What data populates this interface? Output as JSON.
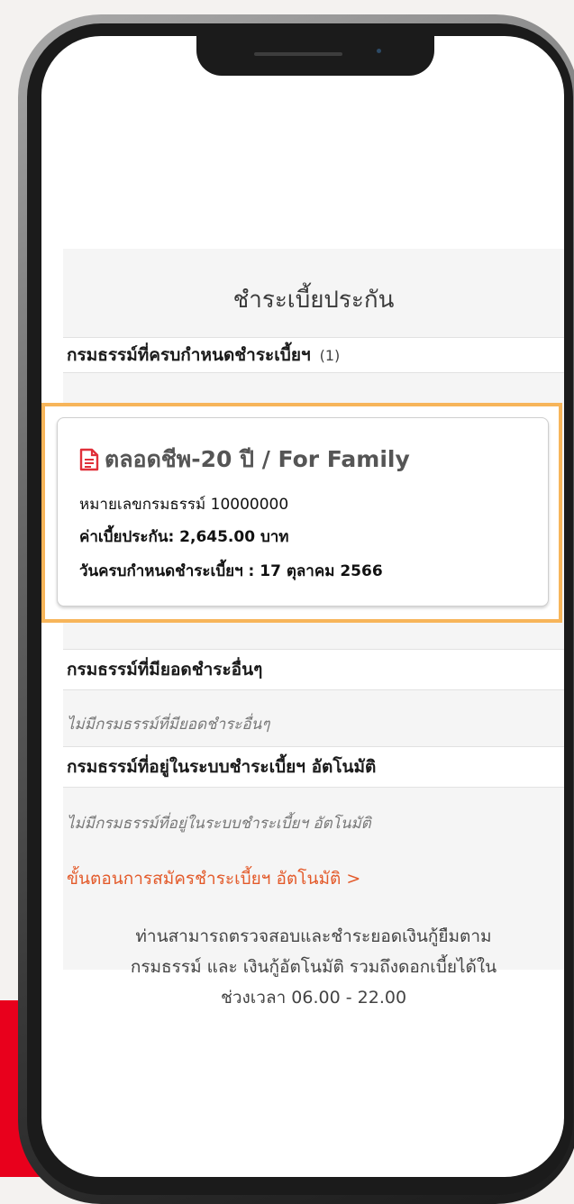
{
  "page": {
    "title": "ชำระเบี้ยประกัน"
  },
  "due_section": {
    "header": "กรมธรรม์ที่ครบกำหนดชำระเบี้ยฯ",
    "count": "(1)",
    "policy": {
      "icon": "document-icon",
      "name": "ตลอดชีพ-20 ปี / For Family",
      "number_label": "หมายเลขกรมธรรม์",
      "number_value": "10000000",
      "premium": "ค่าเบี้ยประกัน: 2,645.00 บาท",
      "due_date": "วันครบกำหนดชำระเบี้ยฯ : 17 ตุลาคม 2566"
    }
  },
  "other_section": {
    "header": "กรมธรรม์ที่มียอดชำระอื่นๆ",
    "empty": "ไม่มีกรมธรรม์ที่มียอดชำระอื่นๆ"
  },
  "auto_section": {
    "header": "กรมธรรม์ที่อยู่ในระบบชำระเบี้ยฯ อัตโนมัติ",
    "empty": "ไม่มีกรมธรรม์ที่อยู่ในระบบชำระเบี้ยฯ อัตโนมัติ",
    "link": "ขั้นตอนการสมัครชำระเบี้ยฯ อัตโนมัติ >"
  },
  "footer": {
    "line1": "ท่านสามารถตรวจสอบและชำระยอดเงินกู้ยืมตาม",
    "line2": "กรมธรรม์ และ เงินกู้อัตโนมัติ รวมถึงดอกเบี้ยได้ใน",
    "line3": "ช่วงเวลา 06.00 - 22.00"
  },
  "colors": {
    "highlight_border": "#f7b55a",
    "link": "#e35a2a",
    "doc_icon": "#e0303a",
    "brand_red": "#e8001c"
  }
}
